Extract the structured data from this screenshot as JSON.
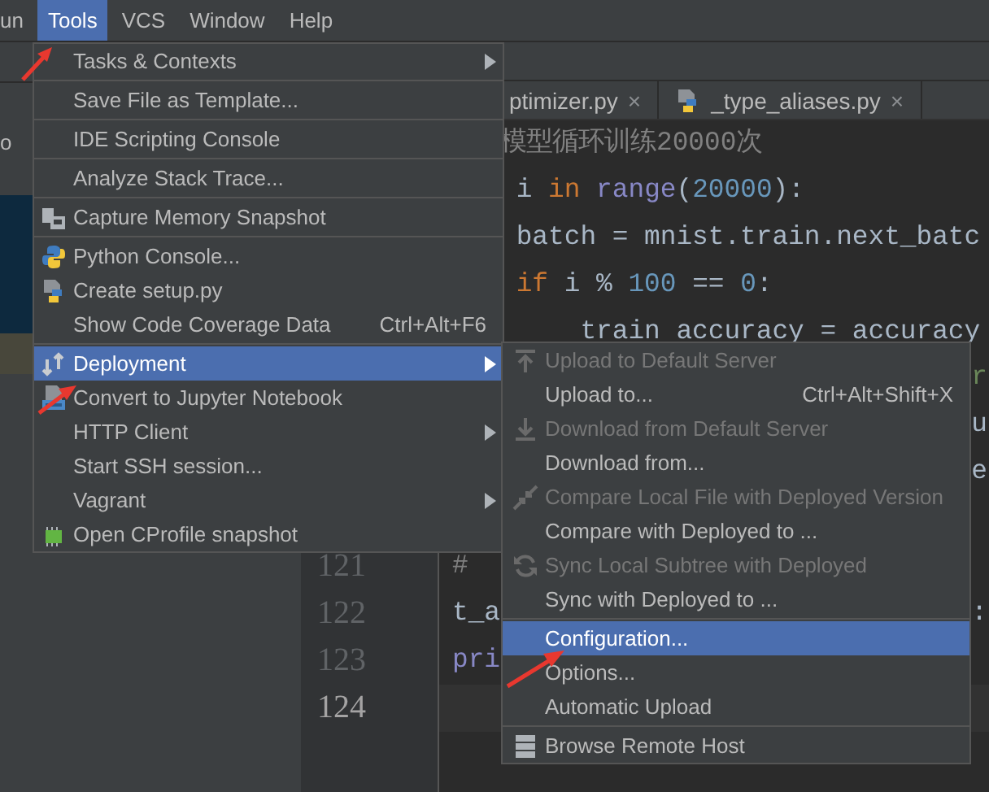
{
  "menubar": [
    {
      "label": "un",
      "selected": false
    },
    {
      "label": "Tools",
      "selected": true
    },
    {
      "label": "VCS",
      "selected": false
    },
    {
      "label": "Window",
      "selected": false
    },
    {
      "label": "Help",
      "selected": false
    }
  ],
  "project_panel": {
    "fragment": "o"
  },
  "tabs": [
    {
      "label": "ptimizer.py",
      "kind": "plain",
      "close": "×"
    },
    {
      "label": "_type_aliases.py",
      "kind": "python",
      "close": "×"
    }
  ],
  "editor": {
    "lines": [
      {
        "kind": "line",
        "tokens": [
          {
            "kind": "comment",
            "text": "   模型循环训练20000次"
          }
        ]
      },
      {
        "kind": "line",
        "tokens": [
          {
            "kind": "plain",
            "text": "    i "
          },
          {
            "kind": "keyword",
            "text": "in"
          },
          {
            "kind": "builtin",
            "text": " range"
          },
          {
            "kind": "plain",
            "text": "("
          },
          {
            "kind": "number",
            "text": "20000"
          },
          {
            "kind": "plain",
            "text": "):"
          }
        ]
      },
      {
        "kind": "line",
        "tokens": [
          {
            "kind": "plain",
            "text": "    batch = mnist.train.next_batc"
          }
        ]
      },
      {
        "kind": "line",
        "tokens": [
          {
            "kind": "keyword",
            "text": "    if"
          },
          {
            "kind": "plain",
            "text": " i % "
          },
          {
            "kind": "number",
            "text": "100"
          },
          {
            "kind": "plain",
            "text": " == "
          },
          {
            "kind": "number",
            "text": "0"
          },
          {
            "kind": "plain",
            "text": ":"
          }
        ]
      },
      {
        "kind": "line",
        "tokens": [
          {
            "kind": "plain",
            "text": "        train accuracy = accuracy"
          }
        ]
      },
      {
        "kind": "line",
        "tail": {
          "kind": "string",
          "text": "r"
        }
      },
      {
        "kind": "line",
        "tail": {
          "kind": "plain",
          "text": "u"
        }
      },
      {
        "kind": "line",
        "tail": {
          "kind": "plain",
          "text": "e"
        }
      },
      {
        "kind": "line"
      },
      {
        "kind": "line",
        "number": "121",
        "tokens": [
          {
            "kind": "comment",
            "text": "#"
          }
        ]
      },
      {
        "kind": "line",
        "number": "122",
        "tokens": [
          {
            "kind": "plain",
            "text": "t_a"
          }
        ],
        "tail": {
          "kind": "plain",
          "text": ":"
        }
      },
      {
        "kind": "line",
        "number": "123",
        "tokens": [
          {
            "kind": "builtin",
            "text": "pri"
          }
        ]
      },
      {
        "kind": "caret_line",
        "number": "124"
      }
    ]
  },
  "tools_menu": {
    "groups": [
      {
        "items": [
          {
            "label": "Tasks & Contexts",
            "kind": "plain",
            "has_submenu": true,
            "selected": false,
            "disabled": false
          }
        ]
      },
      {
        "items": [
          {
            "label": "Save File as Template...",
            "kind": "plain",
            "has_submenu": false,
            "selected": false,
            "disabled": false
          }
        ]
      },
      {
        "items": [
          {
            "label": "IDE Scripting Console",
            "kind": "plain",
            "has_submenu": false,
            "selected": false,
            "disabled": false
          }
        ]
      },
      {
        "items": [
          {
            "label": "Analyze Stack Trace...",
            "kind": "plain",
            "has_submenu": false,
            "selected": false,
            "disabled": false
          }
        ]
      },
      {
        "items": [
          {
            "label": "Capture Memory Snapshot",
            "kind": "memory",
            "has_submenu": false,
            "selected": false,
            "disabled": false
          }
        ]
      },
      {
        "items": [
          {
            "label": "Python Console...",
            "kind": "python",
            "has_submenu": false,
            "selected": false,
            "disabled": false
          },
          {
            "label": "Create setup.py",
            "kind": "setup",
            "has_submenu": false,
            "selected": false,
            "disabled": false
          },
          {
            "label": "Show Code Coverage Data",
            "kind": "plain",
            "shortcut": "Ctrl+Alt+F6",
            "has_submenu": false,
            "selected": false,
            "disabled": false
          }
        ]
      },
      {
        "items": [
          {
            "label": "Deployment",
            "kind": "deploy",
            "has_submenu": true,
            "selected": true,
            "disabled": false
          },
          {
            "label": "Convert to Jupyter Notebook",
            "kind": "jupyter",
            "has_submenu": false,
            "selected": false,
            "disabled": false
          },
          {
            "label": "HTTP Client",
            "kind": "plain",
            "has_submenu": true,
            "selected": false,
            "disabled": false
          },
          {
            "label": "Start SSH session...",
            "kind": "plain",
            "has_submenu": false,
            "selected": false,
            "disabled": false
          },
          {
            "label": "Vagrant",
            "kind": "plain",
            "has_submenu": true,
            "selected": false,
            "disabled": false
          },
          {
            "label": "Open CProfile snapshot",
            "kind": "profile",
            "has_submenu": false,
            "selected": false,
            "disabled": false
          }
        ]
      }
    ]
  },
  "deployment_submenu": {
    "groups": [
      {
        "items": [
          {
            "label": "Upload to Default Server",
            "kind": "upload",
            "has_submenu": false,
            "selected": false,
            "disabled": true
          },
          {
            "label": "Upload to...",
            "kind": "plain",
            "shortcut": "Ctrl+Alt+Shift+X",
            "has_submenu": false,
            "selected": false,
            "disabled": false
          },
          {
            "label": "Download from Default Server",
            "kind": "download",
            "has_submenu": false,
            "selected": false,
            "disabled": true
          },
          {
            "label": "Download from...",
            "kind": "plain",
            "has_submenu": false,
            "selected": false,
            "disabled": false
          },
          {
            "label": "Compare Local File with Deployed Version",
            "kind": "compare",
            "has_submenu": false,
            "selected": false,
            "disabled": true
          },
          {
            "label": "Compare with Deployed to ...",
            "kind": "plain",
            "has_submenu": false,
            "selected": false,
            "disabled": false
          },
          {
            "label": "Sync Local Subtree with Deployed",
            "kind": "sync",
            "has_submenu": false,
            "selected": false,
            "disabled": true
          },
          {
            "label": "Sync with Deployed to ...",
            "kind": "plain",
            "has_submenu": false,
            "selected": false,
            "disabled": false
          }
        ]
      },
      {
        "items": [
          {
            "label": "Configuration...",
            "kind": "plain",
            "has_submenu": false,
            "selected": true,
            "disabled": false
          },
          {
            "label": "Options...",
            "kind": "plain",
            "has_submenu": false,
            "selected": false,
            "disabled": false
          },
          {
            "label": "Automatic Upload",
            "kind": "plain",
            "has_submenu": false,
            "selected": false,
            "disabled": false
          }
        ]
      },
      {
        "items": [
          {
            "label": "Browse Remote Host",
            "kind": "server",
            "has_submenu": false,
            "selected": false,
            "disabled": false
          }
        ]
      }
    ]
  }
}
